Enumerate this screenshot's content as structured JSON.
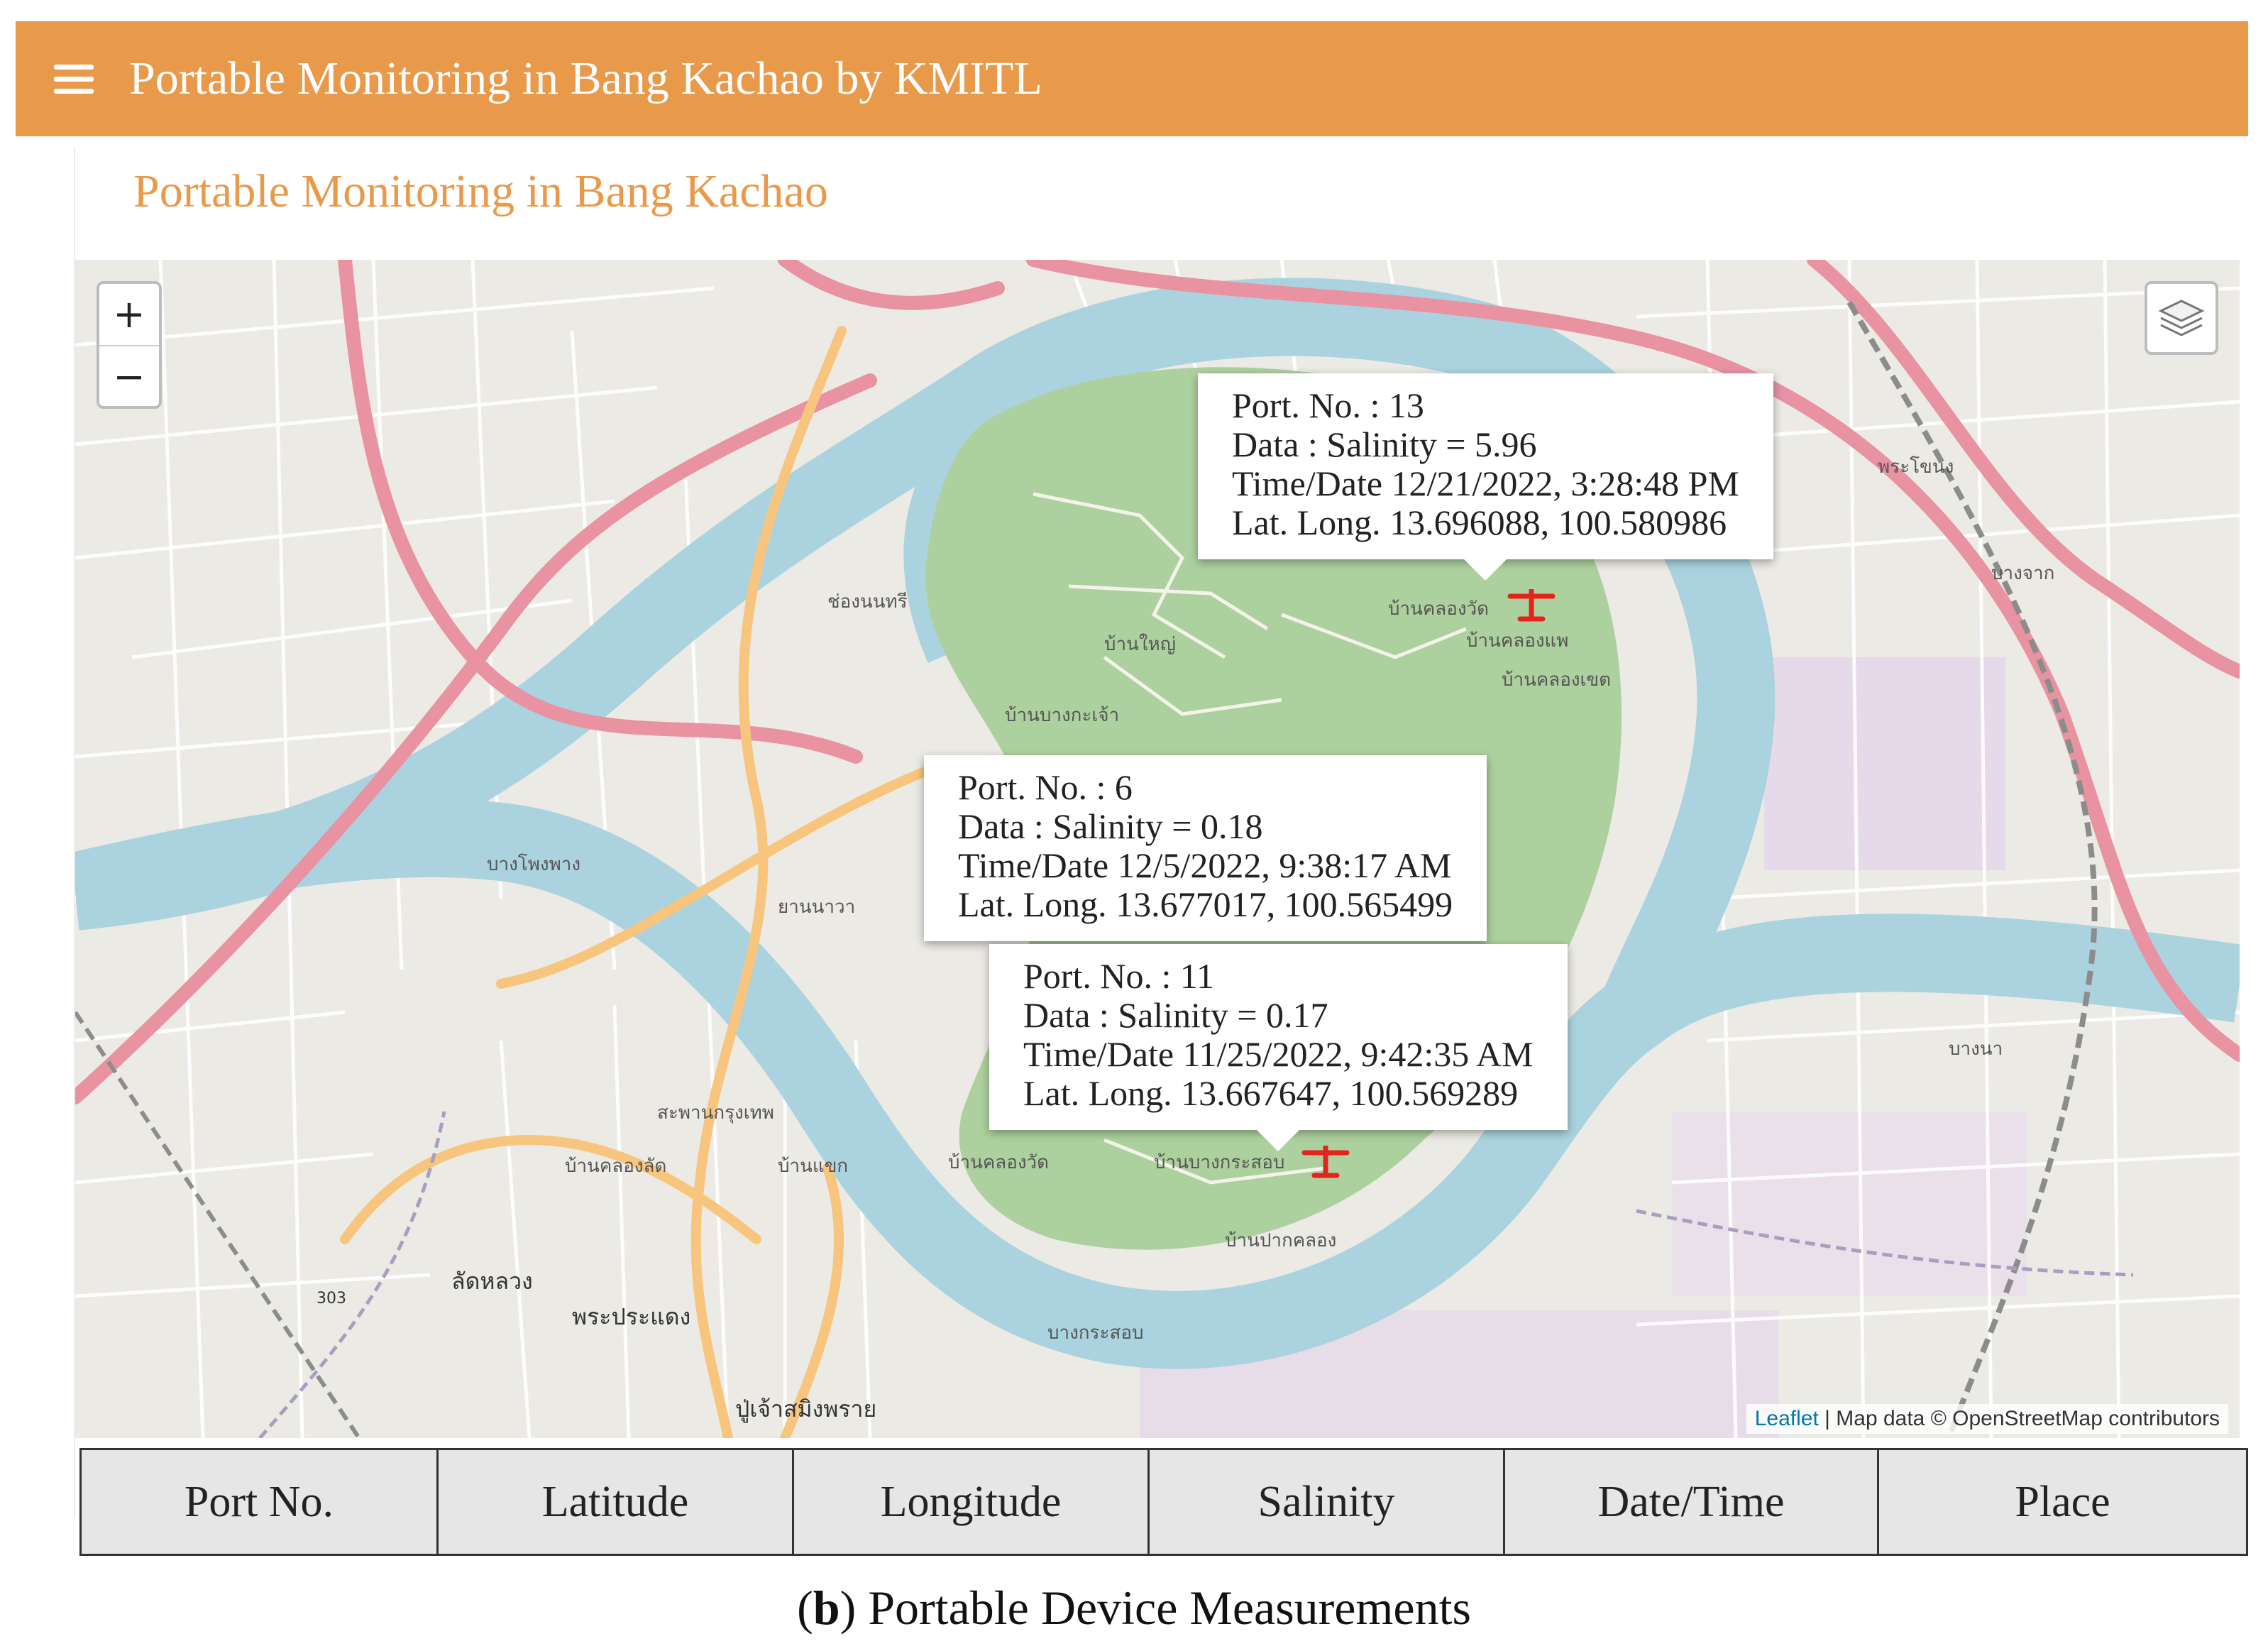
{
  "header": {
    "title": "Portable Monitoring in Bang Kachao by KMITL"
  },
  "page": {
    "title": "Portable Monitoring in Bang Kachao"
  },
  "map": {
    "zoom_in_label": "+",
    "zoom_out_label": "−",
    "attribution_link": "Leaflet",
    "attribution_text": " | Map data © OpenStreetMap contributors",
    "popups": [
      {
        "port": "Port. No. : 13",
        "data": "Data : Salinity = 5.96",
        "time": "Time/Date 12/21/2022, 3:28:48 PM",
        "latlong": "Lat. Long. 13.696088, 100.580986"
      },
      {
        "port": "Port. No. : 6",
        "data": "Data : Salinity = 0.18",
        "time": "Time/Date 12/5/2022, 9:38:17 AM",
        "latlong": "Lat. Long. 13.677017, 100.565499"
      },
      {
        "port": "Port. No. : 11",
        "data": "Data : Salinity = 0.17",
        "time": "Time/Date 11/25/2022, 9:42:35 AM",
        "latlong": "Lat. Long. 13.667647, 100.569289"
      }
    ],
    "labels": [
      "บ้านคลองวัด",
      "บ้านคลองแพ",
      "บ้านคลองเขต",
      "บ้านใหญ่",
      "บ้านบางกะเจ้า",
      "บ้านบางกระสอบ",
      "บ้านปากคลอง",
      "ลัดหลวง",
      "พระประแดง",
      "ปู่เจ้าสมิงพราย",
      "บางกระสอบ",
      "บ้านคลองวัด",
      "บ้านคลองลัด",
      "บ้านแขก",
      "ยานนาวา",
      "บางโพงพาง",
      "ช่องนนทรี",
      "สะพานกรุงเทพ",
      "พระโขนง",
      "บางจาก",
      "บางนา",
      "303"
    ]
  },
  "table": {
    "headers": [
      "Port No.",
      "Latitude",
      "Longitude",
      "Salinity",
      "Date/Time",
      "Place"
    ]
  },
  "caption": {
    "letter": "b",
    "text": " Portable Device Measurements"
  },
  "colors": {
    "header": "#e9994a",
    "river": "#aad3df",
    "park": "#add19e",
    "road_primary": "#e892a2",
    "road_secondary": "#f7c57d",
    "marker": "#e1251b"
  }
}
